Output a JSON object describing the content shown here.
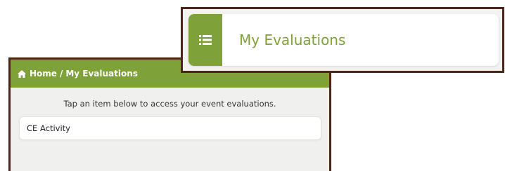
{
  "colors": {
    "accent": "#7ea13a",
    "frame": "#4a2518",
    "background": "#f0f0ee"
  },
  "callout": {
    "icon": "list-icon",
    "title": "My Evaluations"
  },
  "header": {
    "icon": "home-icon",
    "breadcrumb": {
      "home": "Home",
      "separator": "/",
      "current": "My Evaluations"
    }
  },
  "main": {
    "instruction": "Tap an item below to access your event evaluations.",
    "items": [
      {
        "label": "CE Activity"
      }
    ]
  }
}
